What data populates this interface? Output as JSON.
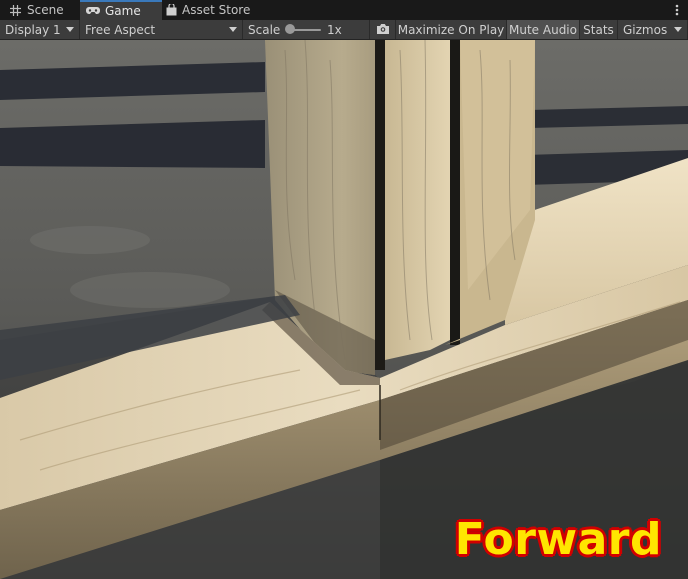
{
  "tabs": [
    {
      "label": "Scene",
      "icon": "grid-icon",
      "active": false
    },
    {
      "label": "Game",
      "icon": "gamepad-icon",
      "active": true
    },
    {
      "label": "Asset Store",
      "icon": "shopping-bag-icon",
      "active": false
    }
  ],
  "toolbar": {
    "display": "Display 1",
    "aspect": "Free Aspect",
    "scale_label": "Scale",
    "scale_value": "1x",
    "maximize": "Maximize On Play",
    "mute": "Mute Audio",
    "stats": "Stats",
    "gizmos": "Gizmos"
  },
  "overlay": {
    "label": "Forward",
    "fill_color": "#ffe600",
    "outline_color": "#d10000"
  }
}
